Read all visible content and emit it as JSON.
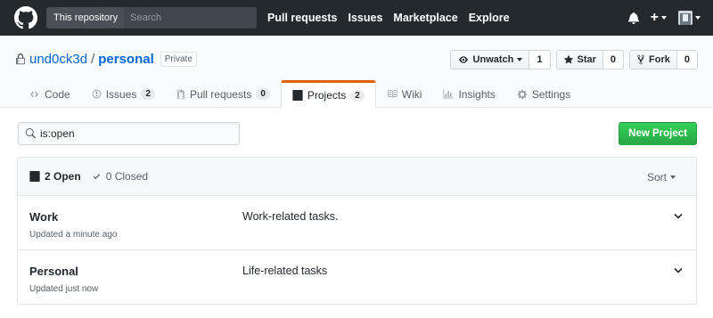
{
  "header": {
    "search_scope": "This repository",
    "search_placeholder": "Search",
    "nav": [
      "Pull requests",
      "Issues",
      "Marketplace",
      "Explore"
    ]
  },
  "repo": {
    "owner": "und0ck3d",
    "separator": "/",
    "name": "personal",
    "visibility": "Private",
    "watch": {
      "label": "Unwatch",
      "count": "1"
    },
    "star": {
      "label": "Star",
      "count": "0"
    },
    "fork": {
      "label": "Fork",
      "count": "0"
    }
  },
  "tabs": [
    {
      "label": "Code",
      "icon": "code-icon"
    },
    {
      "label": "Issues",
      "count": "2",
      "icon": "issue-icon"
    },
    {
      "label": "Pull requests",
      "count": "0",
      "icon": "pull-request-icon"
    },
    {
      "label": "Projects",
      "count": "2",
      "icon": "project-icon",
      "selected": true
    },
    {
      "label": "Wiki",
      "icon": "book-icon"
    },
    {
      "label": "Insights",
      "icon": "graph-icon"
    },
    {
      "label": "Settings",
      "icon": "gear-icon"
    }
  ],
  "filter": {
    "value": "is:open"
  },
  "new_project_label": "New Project",
  "list": {
    "open_label": "2 Open",
    "closed_label": "0 Closed",
    "sort_label": "Sort",
    "projects": [
      {
        "name": "Work",
        "updated": "Updated a minute ago",
        "description": "Work-related tasks."
      },
      {
        "name": "Personal",
        "updated": "Updated just now",
        "description": "Life-related tasks"
      }
    ]
  },
  "colors": {
    "header_bg": "#24292e",
    "link": "#0366d6",
    "accent_tab": "#e36209",
    "primary_button": "#28a745"
  }
}
